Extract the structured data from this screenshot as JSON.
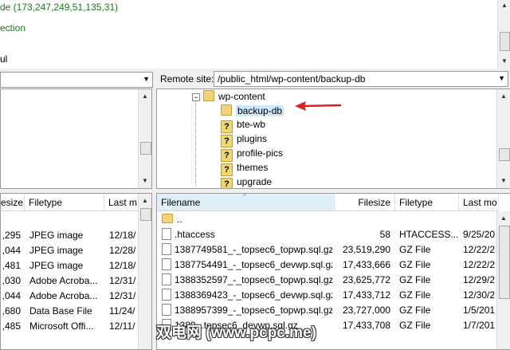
{
  "message_log": {
    "lines": [
      {
        "text": "de (173,247,249,51,135,31)",
        "color": "#1a7a1a"
      },
      {
        "text": "ection",
        "color": "#1a7a1a"
      },
      {
        "text": "",
        "color": "#000000"
      },
      {
        "text": "ul",
        "color": "#000000"
      }
    ]
  },
  "local": {
    "path_value": "",
    "list_headers": {
      "filesize": "esize",
      "filetype": "Filetype",
      "lastmod": "Last m"
    },
    "rows": [
      {
        "size": ",295",
        "type": "JPEG image",
        "date": "12/18/"
      },
      {
        "size": ",044",
        "type": "JPEG image",
        "date": "12/28/"
      },
      {
        "size": ",481",
        "type": "JPEG image",
        "date": "12/18/"
      },
      {
        "size": ",030",
        "type": "Adobe Acroba...",
        "date": "12/31/"
      },
      {
        "size": ",044",
        "type": "Adobe Acroba...",
        "date": "12/31/"
      },
      {
        "size": ",680",
        "type": "Data Base File",
        "date": "11/24/"
      },
      {
        "size": ",485",
        "type": "Microsoft Offi...",
        "date": "12/11/"
      }
    ]
  },
  "remote": {
    "site_label": "Remote site:",
    "path_value": "/public_html/wp-content/backup-db",
    "tree": {
      "parent": "wp-content",
      "children": [
        "backup-db",
        "bte-wb",
        "plugins",
        "profile-pics",
        "themes",
        "upgrade"
      ]
    },
    "list_headers": {
      "filename": "Filename",
      "filesize": "Filesize",
      "filetype": "Filetype",
      "lastmod": "Last mo"
    },
    "rows": [
      {
        "name": "..",
        "size": "",
        "type": "",
        "date": "",
        "kind": "folder"
      },
      {
        "name": ".htaccess",
        "size": "58",
        "type": "HTACCESS...",
        "date": "9/25/20",
        "kind": "file"
      },
      {
        "name": "1387749581_-_topsec6_topwp.sql.gz",
        "size": "23,519,290",
        "type": "GZ File",
        "date": "12/22/2",
        "kind": "file"
      },
      {
        "name": "1387754491_-_topsec6_devwp.sql.gz",
        "size": "17,433,666",
        "type": "GZ File",
        "date": "12/22/2",
        "kind": "file"
      },
      {
        "name": "1388352597_-_topsec6_topwp.sql.gz",
        "size": "23,625,772",
        "type": "GZ File",
        "date": "12/29/2",
        "kind": "file"
      },
      {
        "name": "1388369423_-_topsec6_devwp.sql.gz",
        "size": "17,433,712",
        "type": "GZ File",
        "date": "12/30/2",
        "kind": "file"
      },
      {
        "name": "1388957399_-_topsec6_topwp.sql.gz",
        "size": "23,727,000",
        "type": "GZ File",
        "date": "1/5/201",
        "kind": "file"
      },
      {
        "name": "1389...topsec6_devwp.sql.gz",
        "size": "17,433,708",
        "type": "GZ File",
        "date": "1/7/201",
        "kind": "file"
      }
    ]
  },
  "watermark": "(www.pcpc.me)",
  "colors": {
    "selection": "#cce8ff",
    "arrow": "#e02020",
    "log_green": "#1a7a1a"
  }
}
